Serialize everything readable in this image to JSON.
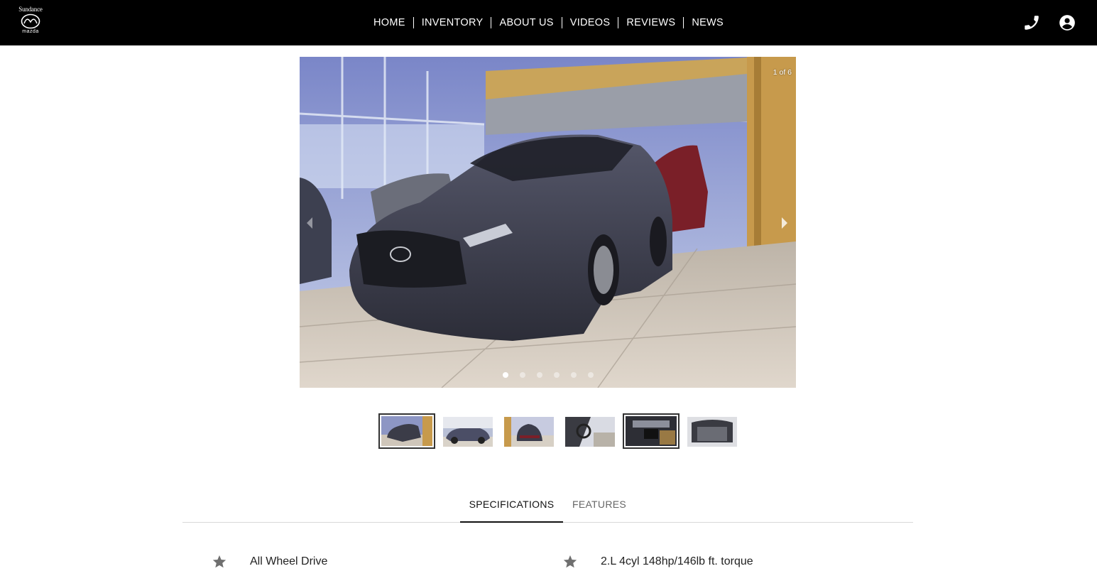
{
  "header": {
    "logo": {
      "top_text": "Sundance",
      "bottom_text": "mazda",
      "icon": "mazda-logo-icon"
    },
    "nav": [
      {
        "label": "HOME"
      },
      {
        "label": "INVENTORY"
      },
      {
        "label": "ABOUT US"
      },
      {
        "label": "VIDEOS"
      },
      {
        "label": "REVIEWS"
      },
      {
        "label": "NEWS"
      }
    ],
    "icons": {
      "phone": "phone-icon",
      "account": "account-circle-icon"
    }
  },
  "gallery": {
    "counter": "1 of 6",
    "current_index": 1,
    "total": 6,
    "thumbnails": [
      {
        "name": "thumbnail-1",
        "selected": true
      },
      {
        "name": "thumbnail-2",
        "selected": false
      },
      {
        "name": "thumbnail-3",
        "selected": false
      },
      {
        "name": "thumbnail-4",
        "selected": false
      },
      {
        "name": "thumbnail-5",
        "selected": true
      },
      {
        "name": "thumbnail-6",
        "selected": false
      }
    ]
  },
  "tabs": [
    {
      "label": "SPECIFICATIONS",
      "active": true
    },
    {
      "label": "FEATURES",
      "active": false
    }
  ],
  "specifications": [
    {
      "icon": "star-icon",
      "text": "All Wheel Drive"
    },
    {
      "icon": "star-icon",
      "text": "2.L 4cyl 148hp/146lb ft. torque"
    }
  ],
  "colors": {
    "header_bg": "#000000",
    "accent": "#111111",
    "icon_gray": "#6f6f6f"
  }
}
